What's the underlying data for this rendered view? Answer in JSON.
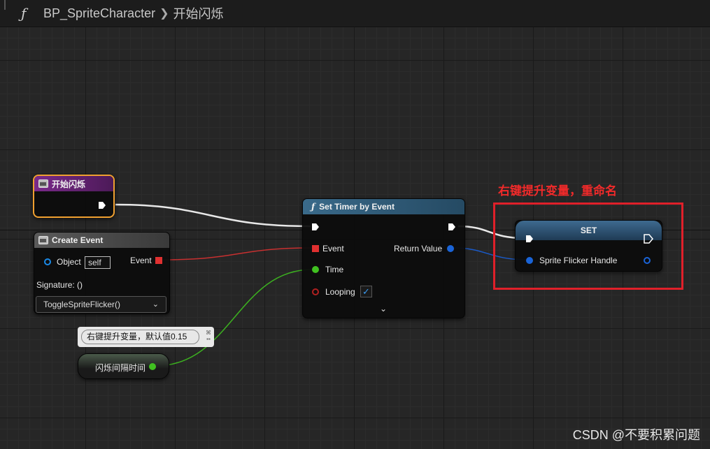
{
  "breadcrumb": {
    "blueprint": "BP_SpriteCharacter",
    "function": "开始闪烁"
  },
  "event_node": {
    "title": "开始闪烁"
  },
  "create_event_node": {
    "title": "Create Event",
    "object_label": "Object",
    "object_value": "self",
    "event_label": "Event",
    "signature": "Signature: ()",
    "function_value": "ToggleSpriteFlicker()"
  },
  "timer_node": {
    "title": "Set Timer by Event",
    "event_label": "Event",
    "time_label": "Time",
    "looping_label": "Looping",
    "looping_checked": true,
    "return_label": "Return Value"
  },
  "set_node": {
    "title": "SET",
    "var_label": "Sprite Flicker Handle"
  },
  "variable_node": {
    "label": "闪烁间隔时间"
  },
  "comment": {
    "text": "右键提升变量，默认值0.15"
  },
  "annotation": {
    "text": "右键提升变量，重命名"
  },
  "watermark": {
    "text": "CSDN @不要积累问题"
  },
  "colors": {
    "exec": "#ffffff",
    "delegate": "#e03030",
    "float": "#40c020",
    "struct": "#1a64d8",
    "highlight": "#e0202a",
    "selected": "#f0a030"
  }
}
